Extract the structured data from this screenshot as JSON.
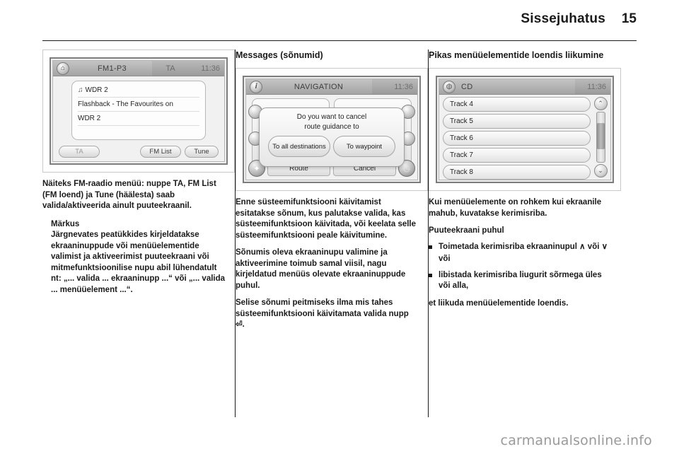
{
  "header": {
    "title": "Sissejuhatus",
    "page_number": "15"
  },
  "columns": {
    "left": {
      "figure": {
        "titlebar": {
          "home_icon": "home-icon",
          "source": "FM1-P3",
          "ta": "TA",
          "clock": "11:36"
        },
        "rows": [
          {
            "icon": "music-note-icon",
            "text": "WDR 2"
          },
          {
            "icon": "",
            "text": "Flashback - The Favourites on"
          },
          {
            "icon": "",
            "text": "WDR 2"
          },
          {
            "icon": "",
            "text": ""
          }
        ],
        "buttons": {
          "ta": "TA",
          "fm_list": "FM List",
          "tune": "Tune"
        }
      },
      "paragraph": "Näiteks FM-raadio menüü: nuppe TA, FM List (FM loend) ja Tune (häälesta) saab valida/aktiveerida ainult puuteekraanil.",
      "note": {
        "title": "Märkus",
        "body": "Järgnevates peatükkides kirjeldatakse ekraaninuppude või menüüelementide valimist ja aktiveerimist puuteekraani või mitmefunktsioonilise nupu abil lühendatult nt: „... valida ... ekraaninupp ...“ või „... valida ... menüüelement ...“."
      }
    },
    "middle": {
      "title": "Messages (sõnumid)",
      "figure": {
        "titlebar": {
          "info_icon": "info-icon",
          "source": "NAVIGATION",
          "clock": "11:36"
        },
        "dialog": {
          "message_line1": "Do you want to cancel",
          "message_line2": "route guidance to",
          "button_left": "To all destinations",
          "button_right": "To waypoint"
        },
        "bottom_buttons": {
          "route": "Route",
          "cancel": "Cancel"
        },
        "corner_icons": {
          "left": "compass-icon",
          "right": "map-icon"
        }
      },
      "paragraphs": [
        "Enne süsteemifunktsiooni käivitamist esitatakse sõnum, kus palutakse valida, kas süsteemifunktsioon käivitada, või keelata selle süsteemifunktsiooni peale käivitumine.",
        "Sõnumis oleva ekraaninupu valimine ja aktiveerimine toimub samal viisil, nagu kirjeldatud menüüs olevate ekraaninuppude puhul.",
        "Selise sõnumi peitmiseks ilma mis tahes süsteemifunktsiooni käivitamata valida nupp ⏎."
      ]
    },
    "right": {
      "title": "Pikas menüüelementide loendis liikumine",
      "figure": {
        "titlebar": {
          "cd_icon": "disc-icon",
          "source": "CD",
          "clock": "11:36"
        },
        "tracks": [
          "Track 4",
          "Track 5",
          "Track 6",
          "Track 7",
          "Track 8"
        ],
        "scrollbar": {
          "up_icon": "chevron-up-icon",
          "down_icon": "chevron-down-icon"
        }
      },
      "paragraph": "Kui menüüelemente on rohkem kui ekraanile mahub, kuvatakse kerimisriba.",
      "subtitle": "Puuteekraani puhul",
      "bullets": [
        "Toimetada kerimisriba ekraaninupul ∧ või ∨",
        "libistada kerimisriba liugurit sõrmega üles või alla,"
      ],
      "or_word": "või",
      "closing": "et liikuda menüüelementide loendis."
    }
  },
  "watermark": "carmanualsonline.info"
}
